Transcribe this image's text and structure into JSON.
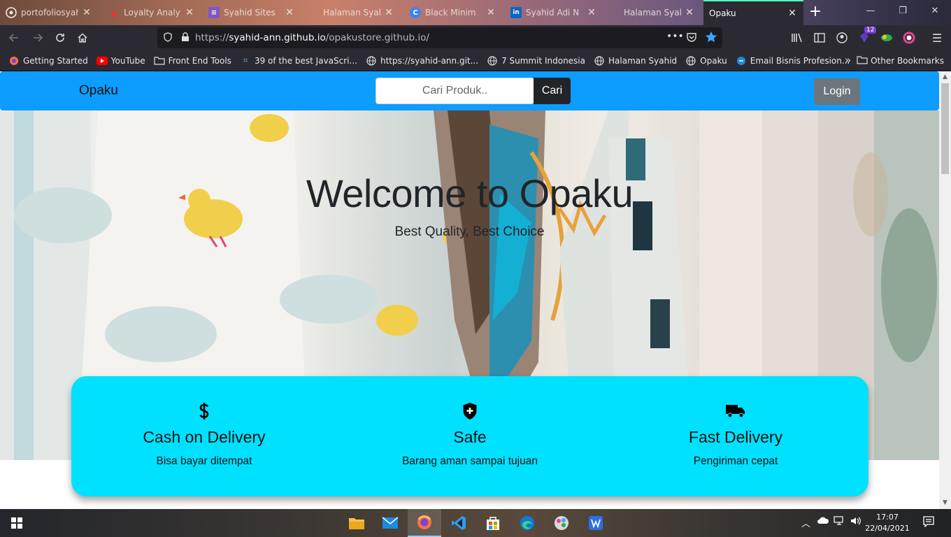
{
  "browser": {
    "tabs": [
      {
        "title": "portofoliosyah",
        "icon": "github-icon"
      },
      {
        "title": "Loyalty Analy",
        "icon": "loyalty-icon"
      },
      {
        "title": "Syahid Sites",
        "icon": "list-icon"
      },
      {
        "title": "Halaman Syahid",
        "icon": "page-icon"
      },
      {
        "title": "Black Minim",
        "icon": "canva-icon"
      },
      {
        "title": "Syahid Adi N",
        "icon": "linkedin-icon"
      },
      {
        "title": "Halaman Syahid",
        "icon": "page-icon"
      },
      {
        "title": "Opaku",
        "icon": "none",
        "active": true
      }
    ],
    "url_prefix": "https://",
    "url_host": "syahid-ann.github.io",
    "url_path": "/opakustore.github.io/",
    "extension_badge": "12",
    "bookmarks": [
      {
        "label": "Getting Started",
        "icon": "firefox-icon"
      },
      {
        "label": "YouTube",
        "icon": "youtube-icon"
      },
      {
        "label": "Front End Tools",
        "icon": "folder-icon"
      },
      {
        "label": "39 of the best JavaScri...",
        "icon": "code-icon"
      },
      {
        "label": "https://syahid-ann.git...",
        "icon": "globe-icon"
      },
      {
        "label": "7 Summit Indonesia",
        "icon": "globe-icon"
      },
      {
        "label": "Halaman Syahid",
        "icon": "globe-icon"
      },
      {
        "label": "Opaku",
        "icon": "globe-icon"
      },
      {
        "label": "Email Bisnis Profesion...",
        "icon": "edge-icon"
      }
    ],
    "other_bookmarks": "Other Bookmarks"
  },
  "site": {
    "brand": "Opaku",
    "search": {
      "placeholder": "Cari Produk..",
      "button": "Cari"
    },
    "login": "Login",
    "hero": {
      "title": "Welcome to Opaku",
      "subtitle": "Best Quality, Best Choice"
    },
    "features": [
      {
        "icon": "dollar-icon",
        "title": "Cash on Delivery",
        "desc": "Bisa bayar ditempat"
      },
      {
        "icon": "shield-plus-icon",
        "title": "Safe",
        "desc": "Barang aman sampai tujuan"
      },
      {
        "icon": "truck-icon",
        "title": "Fast Delivery",
        "desc": "Pengiriman cepat"
      }
    ],
    "colors": {
      "navbar": "#0d9cff",
      "features_card": "#00e1ff",
      "login_button": "#6c757d",
      "search_button": "#212529"
    }
  },
  "taskbar": {
    "apps": [
      "file-explorer-icon",
      "mail-icon",
      "firefox-icon",
      "vscode-icon",
      "store-icon",
      "edge-icon",
      "paint-icon",
      "writer-icon"
    ],
    "time": "17:07",
    "date": "22/04/2021"
  }
}
